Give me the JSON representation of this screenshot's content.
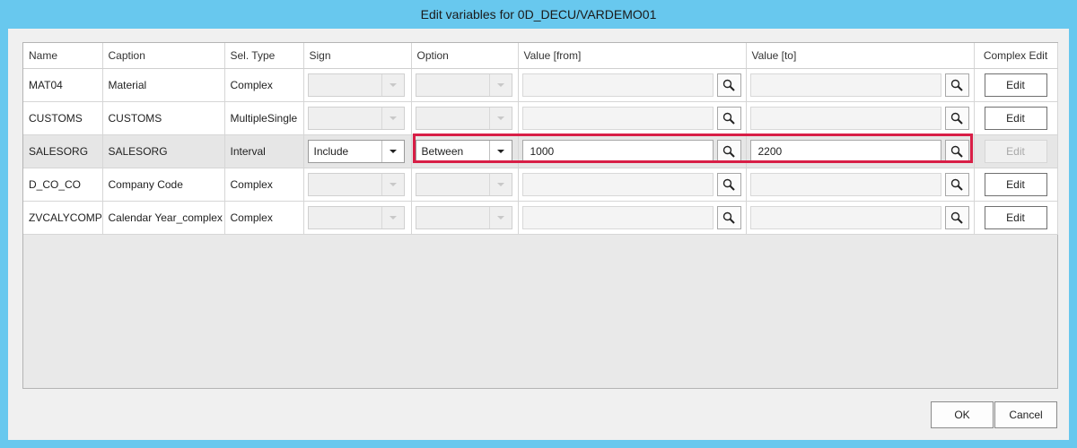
{
  "window": {
    "title": "Edit variables for 0D_DECU/VARDEMO01"
  },
  "columns": {
    "name": "Name",
    "caption": "Caption",
    "sel_type": "Sel. Type",
    "sign": "Sign",
    "option": "Option",
    "value_from": "Value [from]",
    "value_to": "Value [to]",
    "complex_edit": "Complex Edit"
  },
  "rows": [
    {
      "name": "MAT04",
      "caption": "Material",
      "sel_type": "Complex",
      "sign": "",
      "option": "",
      "value_from": "",
      "value_to": "",
      "edit_label": "Edit"
    },
    {
      "name": "CUSTOMS",
      "caption": "CUSTOMS",
      "sel_type": "MultipleSingle",
      "sign": "",
      "option": "",
      "value_from": "",
      "value_to": "",
      "edit_label": "Edit"
    },
    {
      "name": "SALESORG",
      "caption": "SALESORG",
      "sel_type": "Interval",
      "sign": "Include",
      "option": "Between",
      "value_from": "1000",
      "value_to": "2200",
      "edit_label": "Edit"
    },
    {
      "name": "D_CO_CO",
      "caption": "Company Code",
      "sel_type": "Complex",
      "sign": "",
      "option": "",
      "value_from": "",
      "value_to": "",
      "edit_label": "Edit"
    },
    {
      "name": "ZVCALYCOMP",
      "caption": "Calendar Year_complex",
      "sel_type": "Complex",
      "sign": "",
      "option": "",
      "value_from": "",
      "value_to": "",
      "edit_label": "Edit"
    }
  ],
  "buttons": {
    "ok": "OK",
    "cancel": "Cancel"
  },
  "colors": {
    "frame": "#68c8ee",
    "highlight": "#d81e46",
    "selected_row": "#e6e6e6"
  },
  "icons": {
    "search": "search-icon",
    "dropdown": "chevron-down-icon"
  }
}
